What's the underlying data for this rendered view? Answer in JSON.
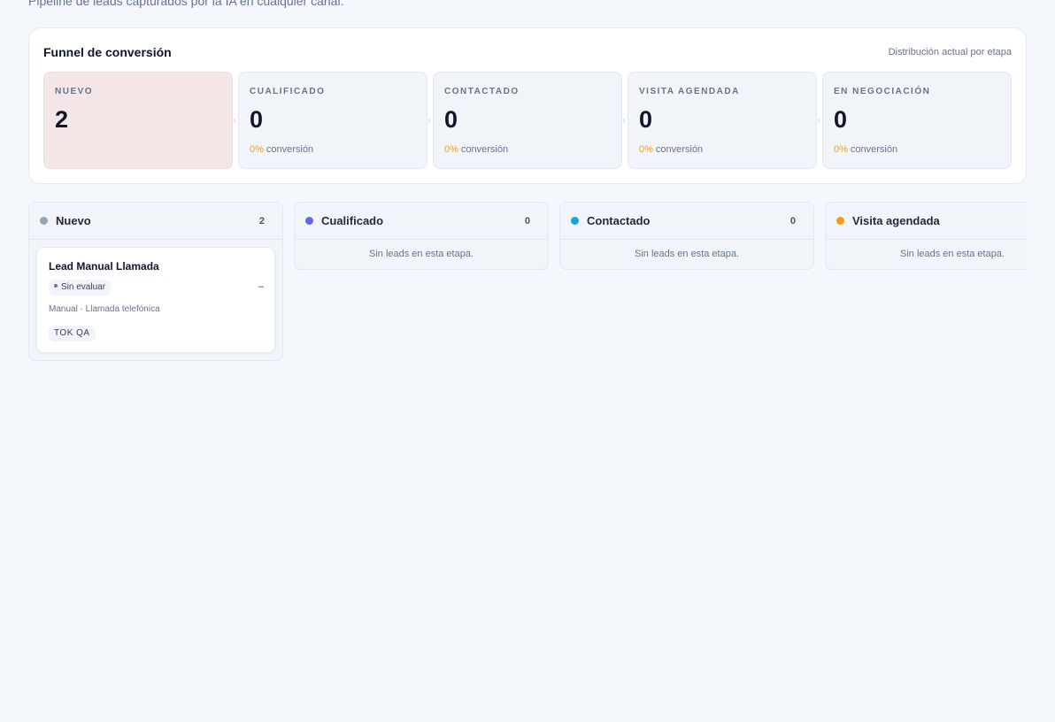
{
  "header": {
    "subtitle": "Pipeline de leads capturados por la IA en cualquier canal."
  },
  "funnel": {
    "title": "Funnel de conversión",
    "subtitle": "Distribución actual por etapa",
    "stages": [
      {
        "name": "NUEVO",
        "count": "2",
        "pct": "",
        "conv_label": ""
      },
      {
        "name": "CUALIFICADO",
        "count": "0",
        "pct": "0%",
        "conv_label": "conversión"
      },
      {
        "name": "CONTACTADO",
        "count": "0",
        "pct": "0%",
        "conv_label": "conversión"
      },
      {
        "name": "VISITA AGENDADA",
        "count": "0",
        "pct": "0%",
        "conv_label": "conversión"
      },
      {
        "name": "EN NEGOCIACIÓN",
        "count": "0",
        "pct": "0%",
        "conv_label": "conversión"
      }
    ]
  },
  "board": {
    "columns": [
      {
        "title": "Nuevo",
        "count": "2",
        "color": "#94a3b8"
      },
      {
        "title": "Cualificado",
        "count": "0",
        "color": "#6366f1",
        "empty": "Sin leads en esta etapa."
      },
      {
        "title": "Contactado",
        "count": "0",
        "color": "#0ea5e9",
        "empty": "Sin leads en esta etapa."
      },
      {
        "title": "Visita agendada",
        "count": "",
        "color": "#f59e0b",
        "empty": "Sin leads en esta etapa."
      }
    ],
    "card": {
      "title": "Lead Manual Llamada",
      "badge": "Sin evaluar",
      "score": "–",
      "meta": "Manual · Llamada telefónica",
      "tag": "TOK QA"
    }
  },
  "colors": {
    "accent_pct": "#f59e0b",
    "active_stage_bg": "#f4e6e6"
  }
}
